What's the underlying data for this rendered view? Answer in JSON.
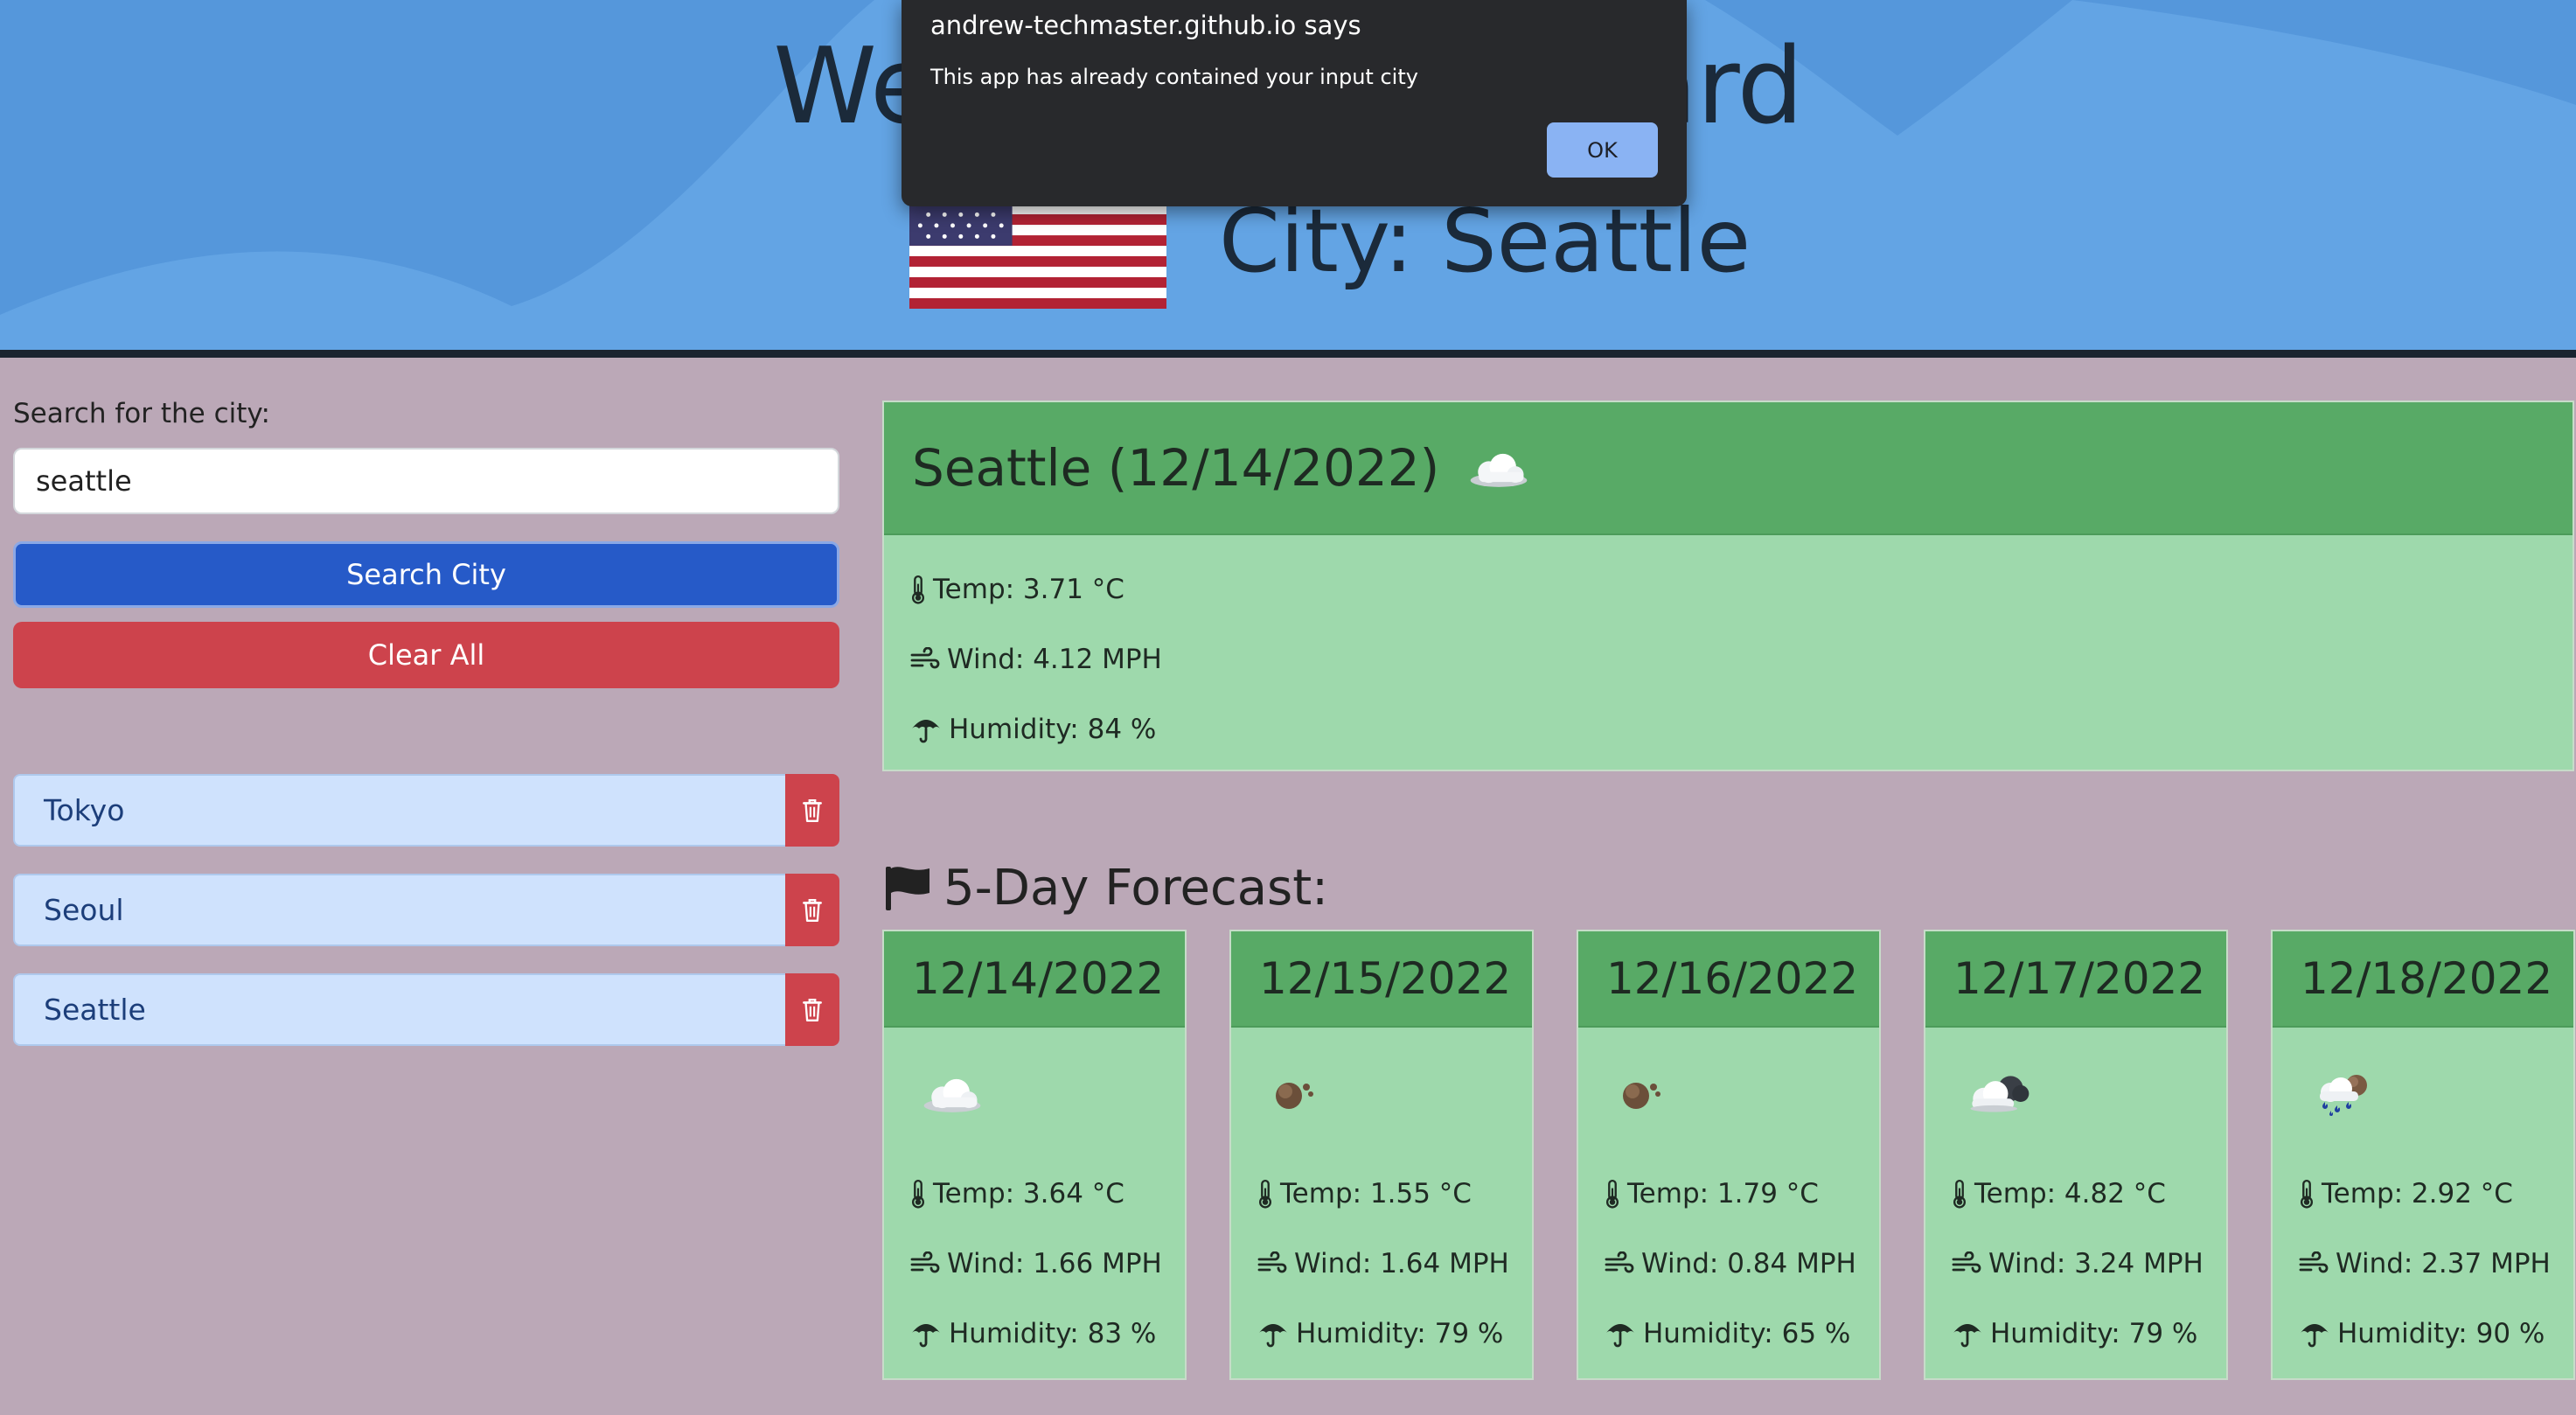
{
  "header": {
    "title": "Weather Dashboard",
    "city_line": "City: Seattle"
  },
  "alert": {
    "origin": "andrew-techmaster.github.io says",
    "message": "This app has already contained your input city",
    "ok_label": "OK"
  },
  "sidebar": {
    "search_label": "Search for the city:",
    "search_value": "seattle",
    "search_button": "Search City",
    "clear_button": "Clear All",
    "history": [
      {
        "label": "Tokyo"
      },
      {
        "label": "Seoul"
      },
      {
        "label": "Seattle"
      }
    ]
  },
  "current": {
    "title": "Seattle (12/14/2022)",
    "icon": "cloud-icon",
    "temp": "Temp: 3.71 °C",
    "wind": "Wind: 4.12 MPH",
    "humidity": "Humidity: 84 %"
  },
  "forecast": {
    "heading": "5-Day Forecast:",
    "days": [
      {
        "date": "12/14/2022",
        "icon": "cloud-icon",
        "temp": "Temp: 3.64 °C",
        "wind": "Wind: 1.66 MPH",
        "humidity": "Humidity: 83 %"
      },
      {
        "date": "12/15/2022",
        "icon": "overcast-icon",
        "temp": "Temp: 1.55 °C",
        "wind": "Wind: 1.64 MPH",
        "humidity": "Humidity: 79 %"
      },
      {
        "date": "12/16/2022",
        "icon": "overcast-icon",
        "temp": "Temp: 1.79 °C",
        "wind": "Wind: 0.84 MPH",
        "humidity": "Humidity: 65 %"
      },
      {
        "date": "12/17/2022",
        "icon": "broken-clouds-icon",
        "temp": "Temp: 4.82 °C",
        "wind": "Wind: 3.24 MPH",
        "humidity": "Humidity: 79 %"
      },
      {
        "date": "12/18/2022",
        "icon": "rain-icon",
        "temp": "Temp: 2.92 °C",
        "wind": "Wind: 2.37 MPH",
        "humidity": "Humidity: 90 %"
      }
    ]
  },
  "colors": {
    "page_bg": "#bba8b7",
    "header_bg": "#63a4e4",
    "card_header": "#58aa66",
    "card_body": "#9ed9ac",
    "search_button": "#265ac8",
    "danger": "#cd434c",
    "history_item": "#cfe2fd"
  }
}
